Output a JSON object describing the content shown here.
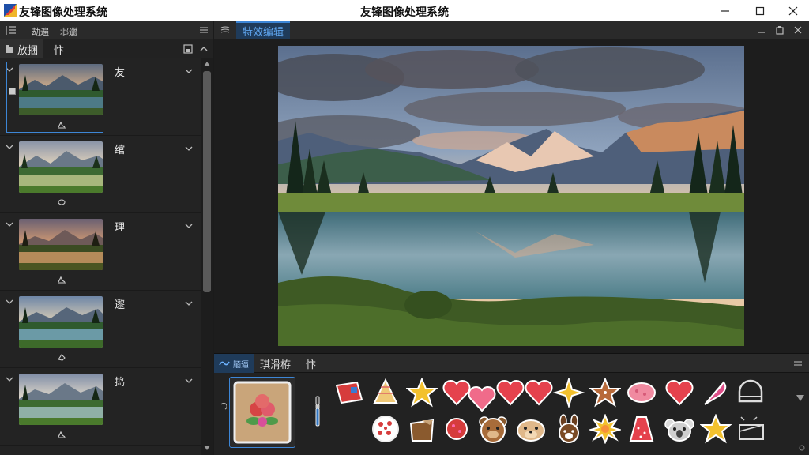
{
  "window": {
    "app_name": "友锋图像处理系统",
    "title": "友锋图像处理系统"
  },
  "left_panel": {
    "tabs": [
      {
        "label": "劫遍"
      },
      {
        "label": "邶邋"
      }
    ],
    "sub_tabs": [
      {
        "label": "放捆"
      },
      {
        "label": "忭"
      }
    ],
    "layers": [
      {
        "label": "友"
      },
      {
        "label": "绾"
      },
      {
        "label": "理"
      },
      {
        "label": "邌"
      },
      {
        "label": "捣"
      }
    ]
  },
  "main_panel": {
    "tab_label": "特效编辑"
  },
  "bottom_panel": {
    "tabs": [
      {
        "label": "腼逼"
      },
      {
        "label": "琪滑栫"
      },
      {
        "label": "忭"
      }
    ]
  },
  "icons": {
    "app_logo": "app-logo-icon",
    "minimize": "minimize-icon",
    "maximize": "maximize-icon",
    "close": "close-icon"
  },
  "colors": {
    "accent": "#3d86d6",
    "panel_bg": "#232323",
    "tab_active_bg": "#1f3b5a",
    "title_bar_bg": "#ffffff"
  }
}
